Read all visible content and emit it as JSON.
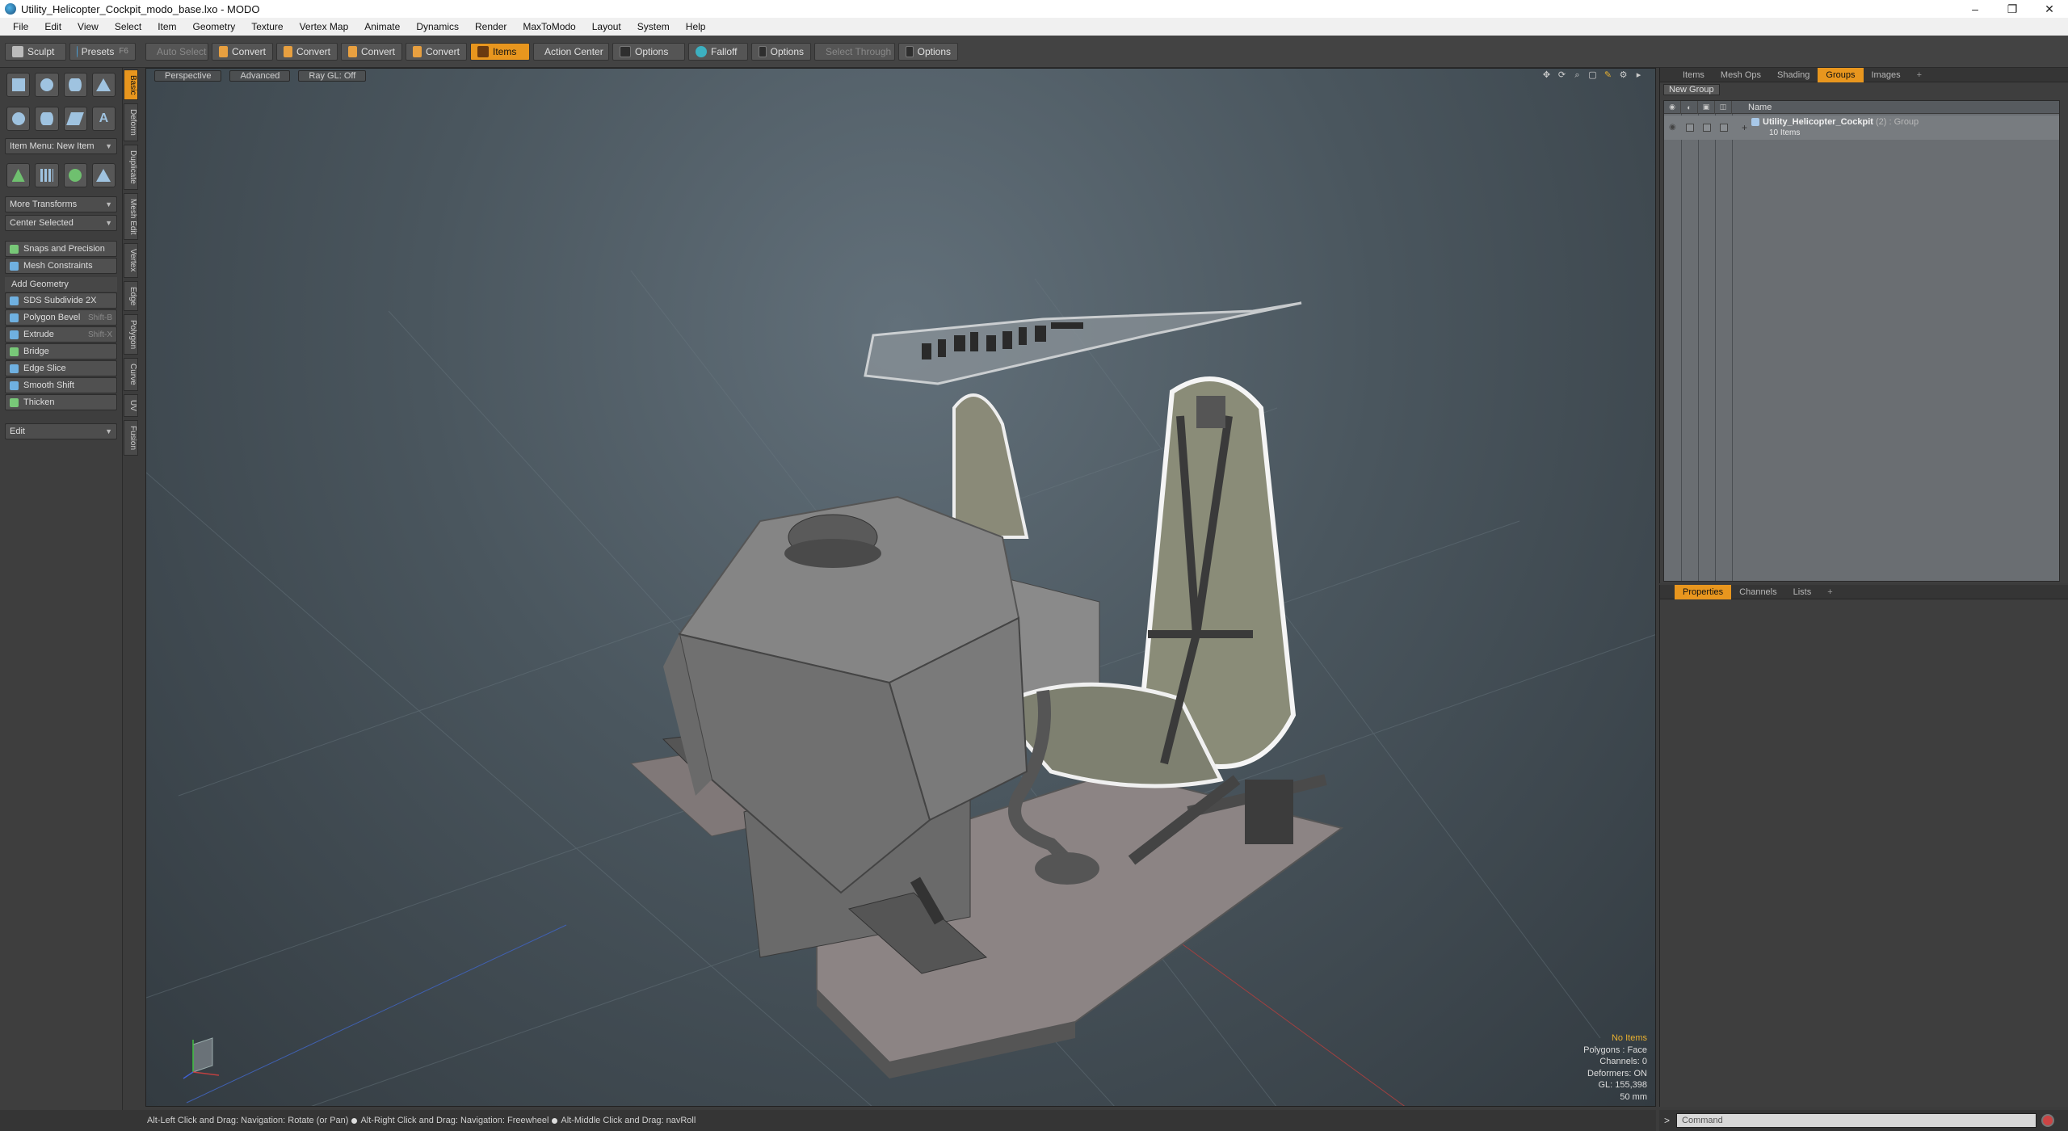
{
  "window": {
    "title": "Utility_Helicopter_Cockpit_modo_base.lxo - MODO",
    "minimize": "–",
    "maximize": "❐",
    "close": "✕"
  },
  "menu": [
    "File",
    "Edit",
    "View",
    "Select",
    "Item",
    "Geometry",
    "Texture",
    "Vertex Map",
    "Animate",
    "Dynamics",
    "Render",
    "MaxToModo",
    "Layout",
    "System",
    "Help"
  ],
  "toolbar": {
    "sculpt": "Sculpt",
    "presets": "Presets",
    "presets_key": "F6",
    "auto_select": "Auto Select",
    "convert1": "Convert",
    "convert2": "Convert",
    "convert3": "Convert",
    "convert4": "Convert",
    "items": "Items",
    "action_center": "Action Center",
    "options1": "Options",
    "falloff": "Falloff",
    "options2": "Options",
    "select_through": "Select Through",
    "options3": "Options"
  },
  "toolbox": {
    "item_menu": "Item Menu: New Item",
    "more_transforms": "More Transforms",
    "center_selected": "Center Selected",
    "snaps": "Snaps and Precision",
    "mesh_constraints": "Mesh Constraints",
    "add_geometry": "Add Geometry",
    "tools": [
      {
        "label": "SDS Subdivide 2X",
        "shortcut": ""
      },
      {
        "label": "Polygon Bevel",
        "shortcut": "Shift-B"
      },
      {
        "label": "Extrude",
        "shortcut": "Shift-X"
      },
      {
        "label": "Bridge",
        "shortcut": ""
      },
      {
        "label": "Edge Slice",
        "shortcut": ""
      },
      {
        "label": "Smooth Shift",
        "shortcut": ""
      },
      {
        "label": "Thicken",
        "shortcut": ""
      }
    ],
    "edit": "Edit",
    "vtabs": [
      "Basic",
      "Deform",
      "Duplicate",
      "Mesh Edit",
      "Vertex",
      "Edge",
      "Polygon",
      "Curve",
      "UV",
      "Fusion"
    ]
  },
  "viewport": {
    "perspective": "Perspective",
    "advanced": "Advanced",
    "raygl": "Ray GL: Off",
    "info": {
      "selection": "No Items",
      "polygons": "Polygons : Face",
      "channels": "Channels: 0",
      "deformers": "Deformers: ON",
      "gl": "GL: 155,398",
      "focal": "50 mm"
    }
  },
  "right_top": {
    "tabs": [
      "Items",
      "Mesh Ops",
      "Shading",
      "Groups",
      "Images"
    ],
    "active_tab": "Groups",
    "new_group": "New Group",
    "name_header": "Name",
    "group_name": "Utility_Helicopter_Cockpit",
    "group_type": "(2) : Group",
    "group_count": "10 Items"
  },
  "right_bot": {
    "tabs": [
      "Properties",
      "Channels",
      "Lists"
    ]
  },
  "status": {
    "hint1": "Alt-Left Click and Drag: Navigation: Rotate (or Pan)",
    "hint2": "Alt-Right Click and Drag: Navigation: Freewheel",
    "hint3": "Alt-Middle Click and Drag: navRoll"
  },
  "command": {
    "prompt": ">",
    "placeholder": "Command"
  },
  "colors": {
    "accent": "#e8961e",
    "viewport_bg": "#4a565e"
  }
}
